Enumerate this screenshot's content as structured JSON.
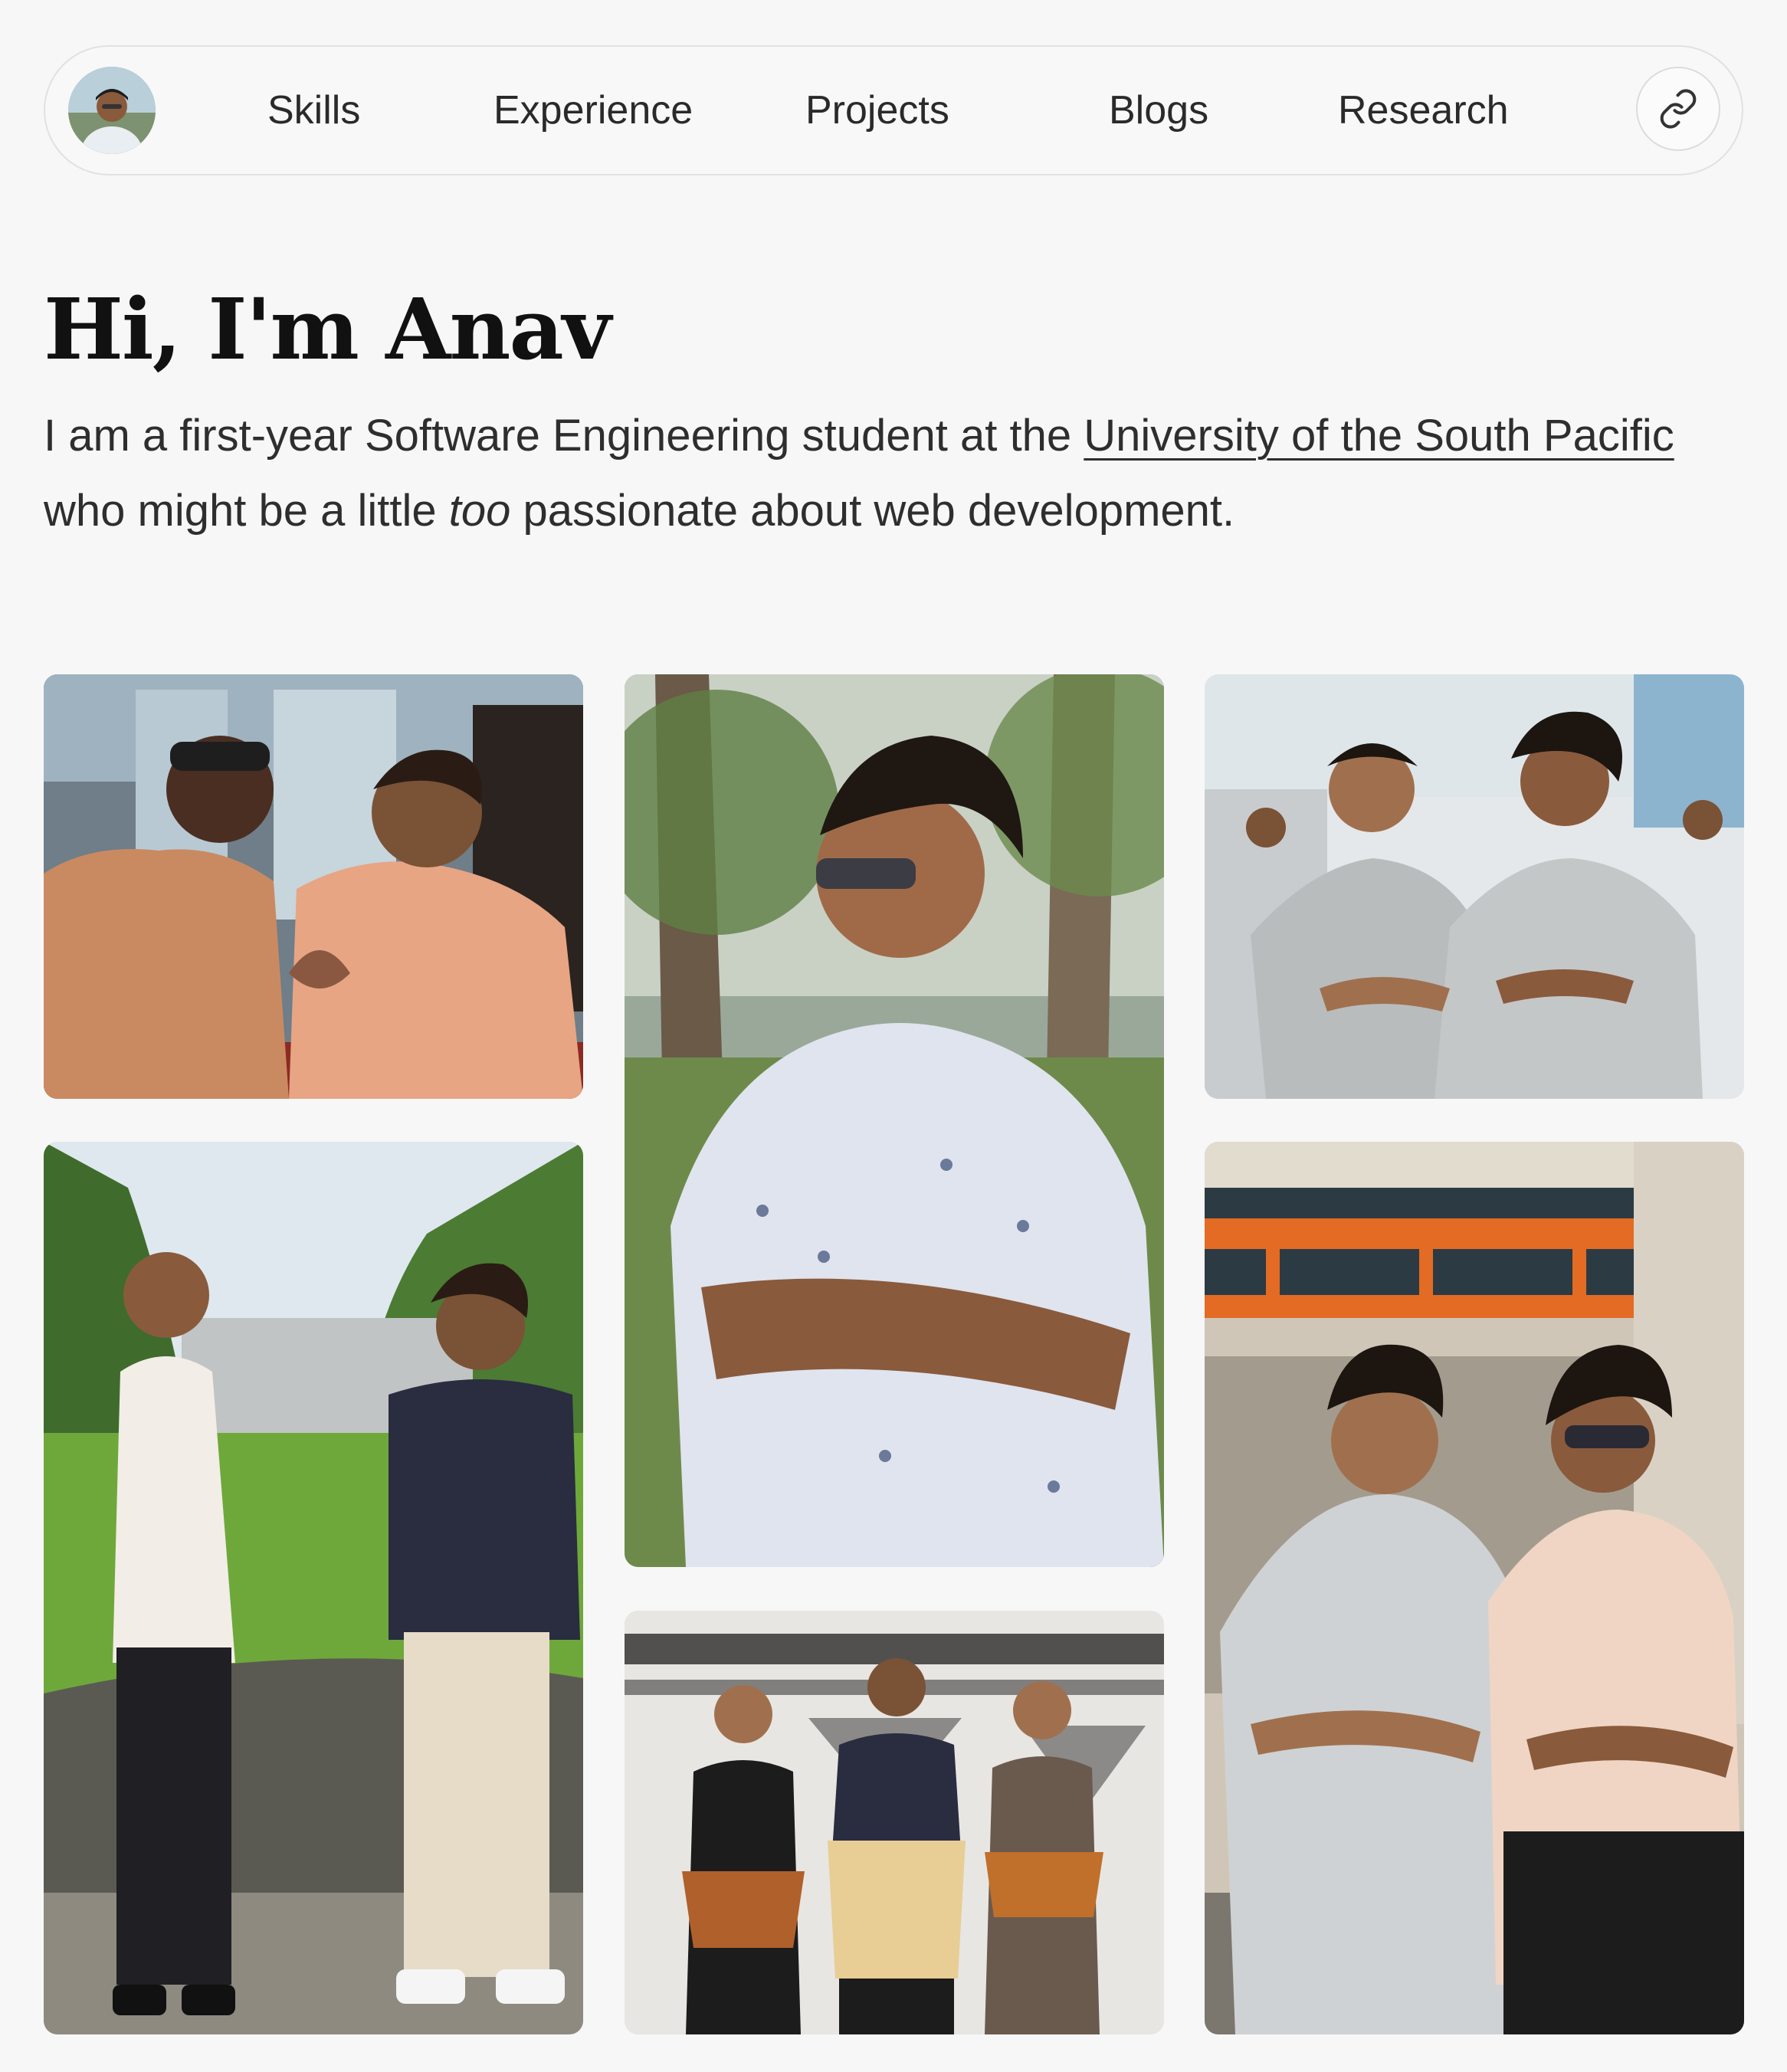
{
  "nav": {
    "avatar_alt": "Anav avatar",
    "links": [
      {
        "label": "Skills"
      },
      {
        "label": "Experience"
      },
      {
        "label": "Projects"
      },
      {
        "label": "Blogs"
      },
      {
        "label": "Research"
      }
    ],
    "external_icon": "link-icon"
  },
  "hero": {
    "title": "Hi, I'm Anav",
    "intro_before": "I am a first-year Software Engineering student at the ",
    "intro_link": "University of the South Pacific",
    "intro_middle": " who might be a little ",
    "intro_emphasis": "too",
    "intro_after": " passionate about web development."
  },
  "gallery": {
    "photos": [
      {
        "name": "photo-friends-heart-hands"
      },
      {
        "name": "photo-portrait-floral-shirt"
      },
      {
        "name": "photo-usp-polo-shirts"
      },
      {
        "name": "photo-two-friends-outdoors"
      },
      {
        "name": "photo-traditional-attire-group"
      },
      {
        "name": "photo-friends-sitting"
      }
    ]
  },
  "colors": {
    "background": "#f7f7f8",
    "text": "#1c1c1c",
    "nav_border": "#e1e1e3"
  }
}
